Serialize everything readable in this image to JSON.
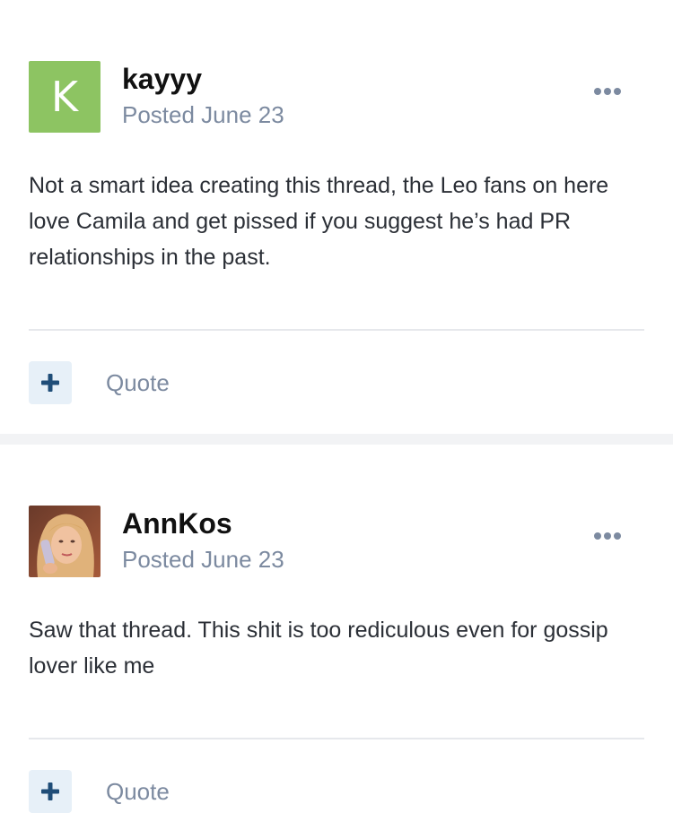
{
  "posts": [
    {
      "username": "kayyy",
      "avatar_letter": "K",
      "posted": "Posted June 23",
      "content": "Not a smart idea creating this thread, the Leo fans on here love Camila and get pissed if you suggest he’s had PR relationships in the past.",
      "quote_label": "Quote"
    },
    {
      "username": "AnnKos",
      "posted": "Posted June 23",
      "content": "Saw that thread. This shit is too rediculous even for gossip lover like me",
      "quote_label": "Quote"
    }
  ],
  "icons": {
    "more": "more-horizontal-icon",
    "plus": "plus-icon"
  },
  "colors": {
    "avatar_green": "#8dc462",
    "meta_gray": "#7c8aa0",
    "plus_navy": "#1f4d78",
    "plus_bg": "#e7f0f8"
  }
}
